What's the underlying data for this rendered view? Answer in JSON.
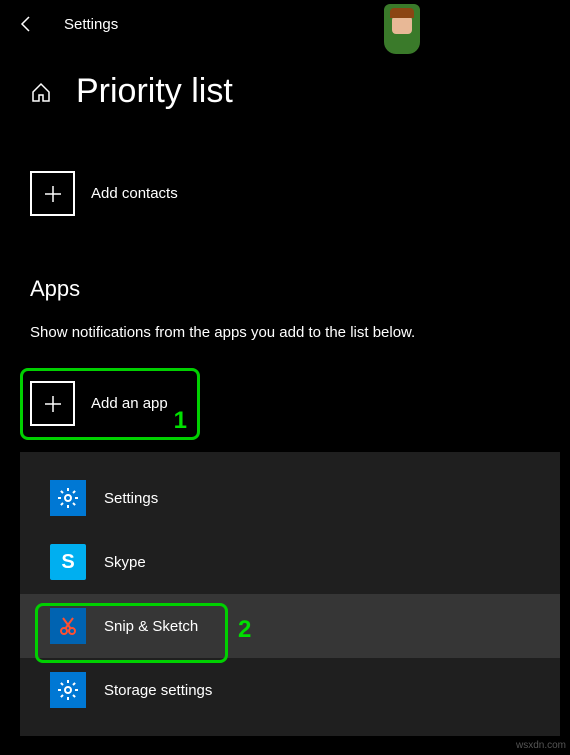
{
  "header": {
    "title": "Settings"
  },
  "page": {
    "title": "Priority list"
  },
  "actions": {
    "add_contacts": "Add contacts",
    "add_app": "Add an app"
  },
  "sections": {
    "apps_heading": "Apps",
    "apps_desc": "Show notifications from the apps you add to the list below."
  },
  "app_list": [
    {
      "label": "Settings",
      "icon": "gear"
    },
    {
      "label": "Skype",
      "icon": "skype"
    },
    {
      "label": "Snip & Sketch",
      "icon": "snip"
    },
    {
      "label": "Storage settings",
      "icon": "gear"
    }
  ],
  "annotations": {
    "marker1": "1",
    "marker2": "2"
  },
  "watermark": "wsxdn.com"
}
